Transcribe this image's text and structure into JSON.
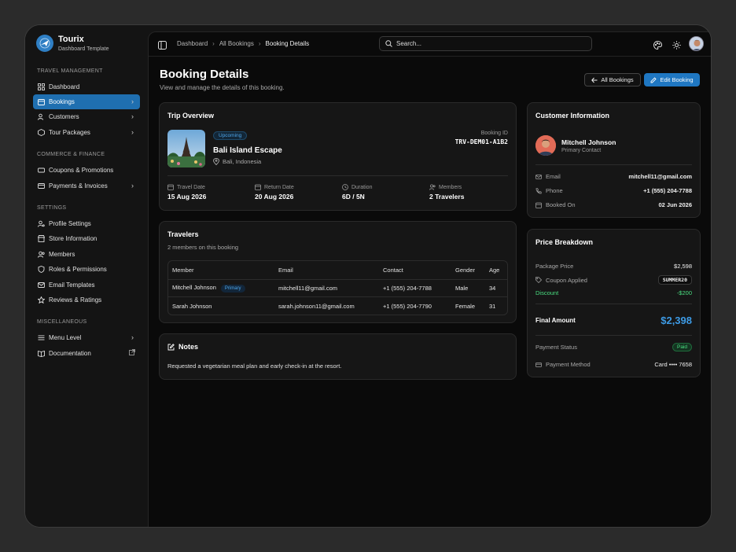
{
  "brand": {
    "name": "Tourix",
    "subtitle": "Dashboard Template"
  },
  "sidebar": {
    "sections": [
      {
        "title": "TRAVEL MANAGEMENT"
      },
      {
        "title": "COMMERCE & FINANCE"
      },
      {
        "title": "SETTINGS"
      },
      {
        "title": "MISCELLANEOUS"
      }
    ],
    "items": [
      {
        "label": "Dashboard",
        "icon": "grid-icon"
      },
      {
        "label": "Bookings",
        "icon": "calendar-icon",
        "active": true
      },
      {
        "label": "Customers",
        "icon": "users-icon"
      },
      {
        "label": "Tour Packages",
        "icon": "box-icon"
      },
      {
        "label": "Coupons & Promotions",
        "icon": "ticket-icon"
      },
      {
        "label": "Payments & Invoices",
        "icon": "card-icon"
      },
      {
        "label": "Profile Settings",
        "icon": "user-cog-icon"
      },
      {
        "label": "Store Information",
        "icon": "store-icon"
      },
      {
        "label": "Members",
        "icon": "users-icon"
      },
      {
        "label": "Roles & Permissions",
        "icon": "shield-icon"
      },
      {
        "label": "Email Templates",
        "icon": "mail-icon"
      },
      {
        "label": "Reviews & Ratings",
        "icon": "star-icon"
      },
      {
        "label": "Menu Level",
        "icon": "menu-icon"
      },
      {
        "label": "Documentation",
        "icon": "book-icon"
      }
    ]
  },
  "topbar": {
    "breadcrumb": [
      "Dashboard",
      "All Bookings",
      "Booking Details"
    ],
    "search_placeholder": "Search..."
  },
  "page": {
    "title": "Booking Details",
    "subtitle": "View and manage the details of this booking.",
    "back_label": "All Bookings",
    "edit_label": "Edit Booking"
  },
  "trip": {
    "title": "Trip Overview",
    "status": "Upcoming",
    "name": "Bali Island Escape",
    "location": "Bali, Indonesia",
    "booking_id_label": "Booking ID",
    "booking_id": "TRV-DEM01-A1B2",
    "travel_date_label": "Travel Date",
    "travel_date": "15 Aug 2026",
    "return_date_label": "Return Date",
    "return_date": "20 Aug 2026",
    "duration_label": "Duration",
    "duration": "6D / 5N",
    "members_label": "Members",
    "members": "2 Travelers"
  },
  "travelers": {
    "title": "Travelers",
    "subtitle": "2 members on this booking",
    "columns": [
      "Member",
      "Email",
      "Contact",
      "Gender",
      "Age"
    ],
    "rows": [
      {
        "name": "Mitchell Johnson",
        "tag": "Primary",
        "email": "mitchell11@gmail.com",
        "contact": "+1 (555) 204-7788",
        "gender": "Male",
        "age": "34"
      },
      {
        "name": "Sarah Johnson",
        "tag": "",
        "email": "sarah.johnson11@gmail.com",
        "contact": "+1 (555) 204-7790",
        "gender": "Female",
        "age": "31"
      }
    ]
  },
  "notes": {
    "title": "Notes",
    "text": "Requested a vegetarian meal plan and early check-in at the resort."
  },
  "customer": {
    "title": "Customer Information",
    "name": "Mitchell Johnson",
    "role": "Primary Contact",
    "email_label": "Email",
    "email": "mitchell11@gmail.com",
    "phone_label": "Phone",
    "phone": "+1 (555) 204-7788",
    "booked_label": "Booked On",
    "booked": "02 Jun 2026"
  },
  "price": {
    "title": "Price Breakdown",
    "package_label": "Package Price",
    "package": "$2,598",
    "coupon_label": "Coupon Applied",
    "coupon": "SUMMER20",
    "discount_label": "Discount",
    "discount": "-$200",
    "final_label": "Final Amount",
    "final": "$2,398",
    "status_label": "Payment Status",
    "status": "Paid",
    "method_label": "Payment Method",
    "method": "Card •••• 7658"
  },
  "colors": {
    "accent": "#1f77c2",
    "success": "#4ade80",
    "background": "#0a0a0a",
    "card": "#161616"
  }
}
